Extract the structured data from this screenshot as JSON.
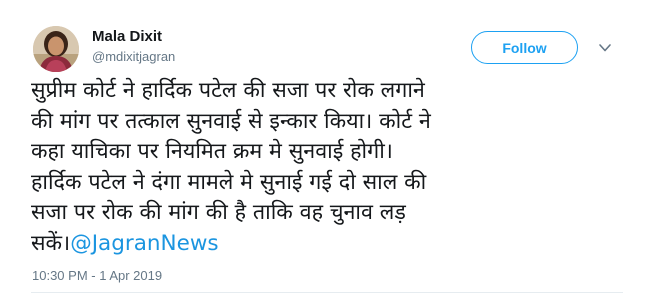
{
  "author": {
    "name": "Mala Dixit",
    "handle": "@mdixitjagran"
  },
  "follow_button": {
    "label": "Follow"
  },
  "tweet": {
    "lines": [
      "सुप्रीम कोर्ट ने हार्दिक पटेल की सजा पर रोक लगाने",
      "की मांग पर तत्काल सुनवाई से इन्कार किया। कोर्ट ने",
      "कहा याचिका पर नियमित क्रम मे सुनवाई होगी।",
      "हार्दिक पटेल ने दंगा मामले मे सुनाई गई दो साल की",
      "सजा पर रोक की मांग की है ताकि वह चुनाव लड़"
    ],
    "last_line_prefix": "सकें।",
    "mention": "@JagranNews",
    "timestamp": "10:30 PM - 1 Apr 2019"
  },
  "icons": {
    "avatar": "profile-photo",
    "menu": "chevron-down-icon"
  },
  "colors": {
    "accent": "#1da1f2",
    "mention": "#1b95e0",
    "secondary_text": "#657786"
  }
}
